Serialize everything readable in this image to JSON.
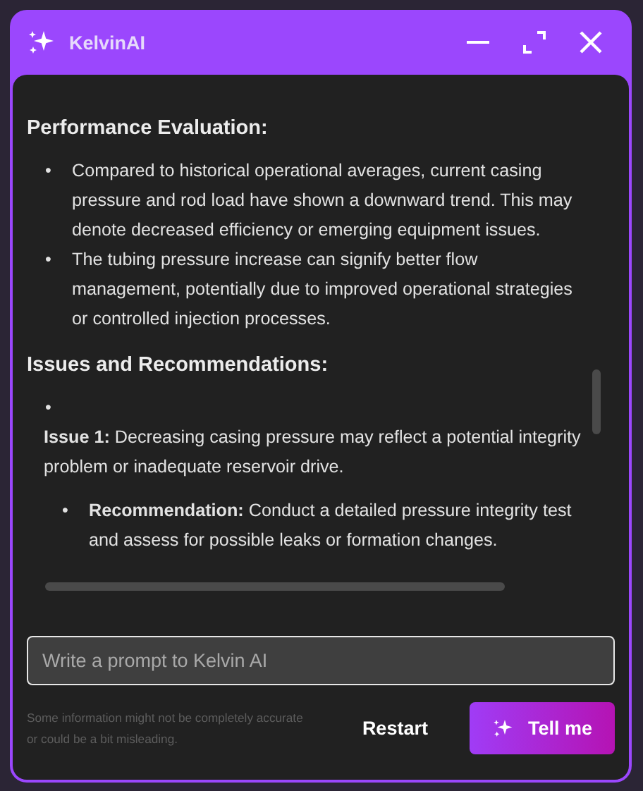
{
  "window": {
    "title": "KelvinAI"
  },
  "response": {
    "sections": [
      {
        "heading": "Performance Evaluation:",
        "items": [
          {
            "kind": "bullet",
            "marker": "•",
            "text": "Compared to historical operational averages, current casing pressure and rod load have shown a downward trend. This may denote decreased efficiency or emerging equipment issues."
          },
          {
            "kind": "bullet",
            "marker": "•",
            "text": "The tubing pressure increase can signify better flow management, potentially due to improved operational strategies or controlled injection processes."
          }
        ]
      },
      {
        "heading": "Issues and Recommendations:",
        "items": [
          {
            "kind": "bullet",
            "marker": "•"
          },
          {
            "kind": "paragraph",
            "text": "**Issue 1:** Decreasing casing pressure may reflect a potential integrity problem or inadequate reservoir drive."
          },
          {
            "kind": "subbullet",
            "marker": "•",
            "text": "**Recommendation:** Conduct a detailed pressure integrity test and assess for possible leaks or formation changes."
          }
        ]
      }
    ]
  },
  "prompt": {
    "placeholder": "Write a prompt to Kelvin AI"
  },
  "disclaimer": "Some information might not be completely accurate or could be a bit misleading.",
  "buttons": [
    {
      "label": "Restart",
      "kind": "secondary"
    },
    {
      "label": "Tell me",
      "kind": "primary"
    }
  ]
}
